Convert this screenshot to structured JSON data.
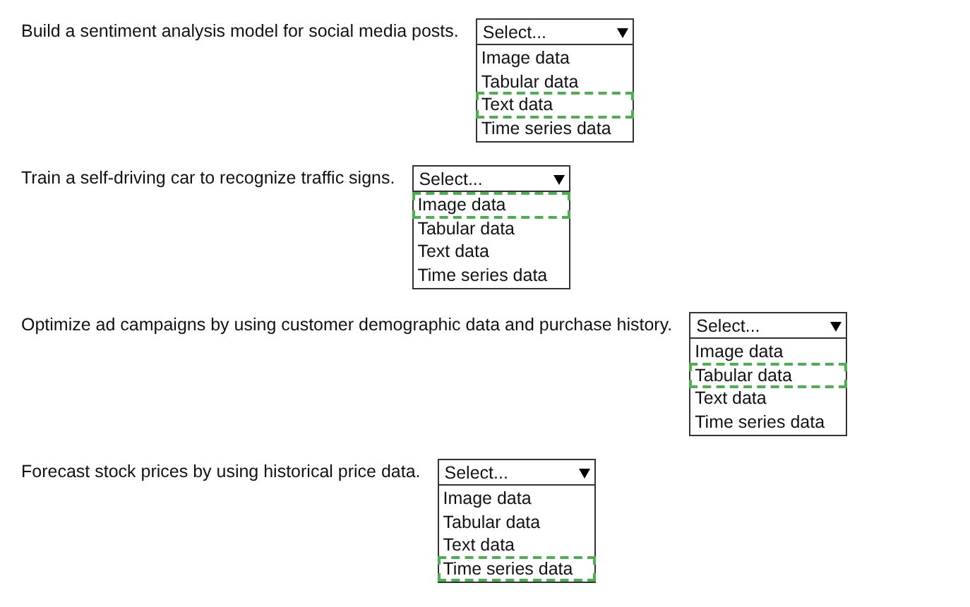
{
  "questions": [
    {
      "statement": "Build a sentiment analysis model for social media posts.",
      "dropdown": {
        "placeholder": "Select...",
        "options": [
          {
            "label": "Image data",
            "selected": false
          },
          {
            "label": "Tabular data",
            "selected": false
          },
          {
            "label": "Text data",
            "selected": true
          },
          {
            "label": "Time series data",
            "selected": false
          }
        ]
      }
    },
    {
      "statement": "Train a self-driving car to recognize traffic signs.",
      "dropdown": {
        "placeholder": "Select...",
        "options": [
          {
            "label": "Image data",
            "selected": true
          },
          {
            "label": "Tabular data",
            "selected": false
          },
          {
            "label": "Text data",
            "selected": false
          },
          {
            "label": "Time series data",
            "selected": false
          }
        ]
      }
    },
    {
      "statement": "Optimize ad campaigns by using customer demographic data and purchase history.",
      "dropdown": {
        "placeholder": "Select...",
        "options": [
          {
            "label": "Image data",
            "selected": false
          },
          {
            "label": "Tabular data",
            "selected": true
          },
          {
            "label": "Text data",
            "selected": false
          },
          {
            "label": "Time series data",
            "selected": false
          }
        ]
      }
    },
    {
      "statement": "Forecast stock prices by using historical price data.",
      "dropdown": {
        "placeholder": "Select...",
        "options": [
          {
            "label": "Image data",
            "selected": false
          },
          {
            "label": "Tabular data",
            "selected": false
          },
          {
            "label": "Text data",
            "selected": false
          },
          {
            "label": "Time series data",
            "selected": true
          }
        ]
      }
    }
  ]
}
